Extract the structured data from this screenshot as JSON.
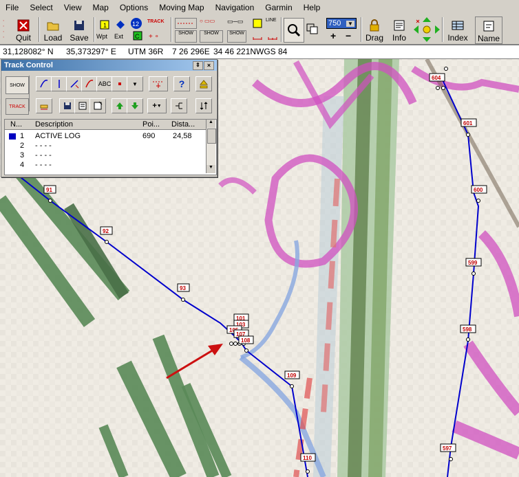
{
  "menu": [
    "File",
    "Select",
    "View",
    "Map",
    "Options",
    "Moving Map",
    "Navigation",
    "Garmin",
    "Help"
  ],
  "toolbar": {
    "quit": "Quit",
    "load": "Load",
    "save": "Save",
    "wpt": "Wpt",
    "ext": "Ext",
    "track": "TRACK",
    "show": "SHOW",
    "zoom_value": "750",
    "drag": "Drag",
    "info": "Info",
    "index": "Index",
    "name": "Name",
    "plus": "+",
    "minus": "−",
    "abc": "ABC",
    "num12": "12",
    "line": "LINE"
  },
  "status": {
    "lat": "31,128082° N",
    "lon": "35,373297° E",
    "utm": "UTM  36R",
    "easting": "7 26 296E",
    "northing": "34 46 221N",
    "datum": "WGS 84"
  },
  "track_control": {
    "title": "Track Control",
    "columns": [
      "N...",
      "Description",
      "Poi...",
      "Dista..."
    ],
    "rows": [
      {
        "n": "1",
        "desc": "ACTIVE LOG",
        "points": "690",
        "dist": "24,58",
        "color": "#0000c0"
      },
      {
        "n": "2",
        "desc": "- - - -",
        "points": "",
        "dist": ""
      },
      {
        "n": "3",
        "desc": "- - - -",
        "points": "",
        "dist": ""
      },
      {
        "n": "4",
        "desc": "- - - -",
        "points": "",
        "dist": ""
      }
    ]
  },
  "waypoints_left": [
    "91",
    "92",
    "93",
    "101",
    "103",
    "105",
    "107",
    "108",
    "109",
    "110"
  ],
  "waypoints_right": [
    "604",
    "601",
    "600",
    "599",
    "598",
    "597"
  ],
  "colors": {
    "track": "#0000cc",
    "label": "#c00000",
    "arrow": "#cc1010"
  }
}
